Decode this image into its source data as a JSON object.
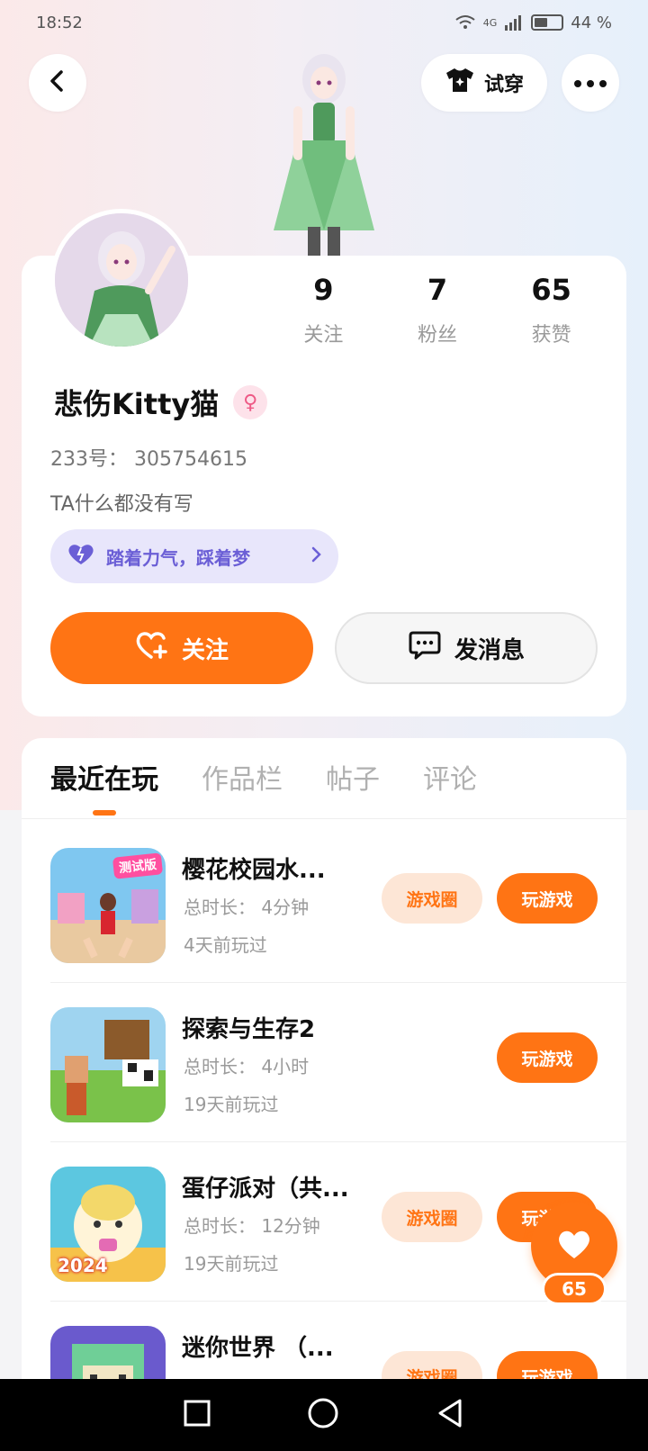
{
  "status_bar": {
    "time": "18:52",
    "network": "4G",
    "battery": "44 %"
  },
  "header": {
    "tryon_label": "试穿"
  },
  "profile": {
    "stats": [
      {
        "num": "9",
        "label": "关注"
      },
      {
        "num": "7",
        "label": "粉丝"
      },
      {
        "num": "65",
        "label": "获赞"
      }
    ],
    "username": "悲伤Kitty猫",
    "gender_icon": "♀",
    "uid": "233号： 305754615",
    "bio": "TA什么都没有写",
    "motto": "踏着力气，踩着梦",
    "follow_label": "关注",
    "message_label": "发消息"
  },
  "tabs": [
    {
      "label": "最近在玩",
      "active": true
    },
    {
      "label": "作品栏",
      "active": false
    },
    {
      "label": "帖子",
      "active": false
    },
    {
      "label": "评论",
      "active": false
    }
  ],
  "games": [
    {
      "name": "樱花校园水...",
      "duration": "总时长： 4分钟",
      "last_played": "4天前玩过",
      "circle_label": "游戏圈",
      "play_label": "玩游戏",
      "badge": "测试版"
    },
    {
      "name": "探索与生存2",
      "duration": "总时长： 4小时",
      "last_played": "19天前玩过",
      "circle_label": "",
      "play_label": "玩游戏",
      "badge": ""
    },
    {
      "name": "蛋仔派对（共...",
      "duration": "总时长： 12分钟",
      "last_played": "19天前玩过",
      "circle_label": "游戏圈",
      "play_label": "玩游戏",
      "badge": "2024"
    },
    {
      "name": "迷你世界 （...",
      "duration": "",
      "last_played": "",
      "circle_label": "游戏圈",
      "play_label": "玩游戏",
      "badge": ""
    }
  ],
  "like_fab": {
    "count": "65"
  },
  "colors": {
    "accent": "#ff7414",
    "motto_bg": "#e8e6fb",
    "motto_text": "#6b5fd6"
  },
  "icons": {
    "back": "chevron-left-icon",
    "tryon": "tshirt-icon",
    "more": "more-dots-icon",
    "motto": "heart-icon",
    "follow": "heart-plus-icon",
    "message": "chat-bubble-icon",
    "like": "heart-icon",
    "nav": [
      "square-icon",
      "circle-icon",
      "triangle-back-icon"
    ]
  }
}
